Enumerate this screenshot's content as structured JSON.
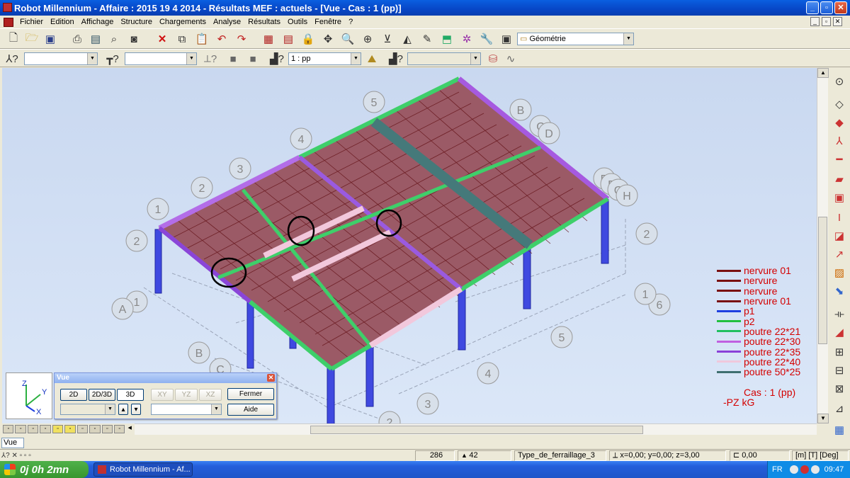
{
  "window": {
    "title": "Robot Millennium - Affaire : 2015 19 4 2014 - Résultats MEF : actuels - [Vue - Cas : 1 (pp)]"
  },
  "menu": [
    "Fichier",
    "Edition",
    "Affichage",
    "Structure",
    "Chargements",
    "Analyse",
    "Résultats",
    "Outils",
    "Fenêtre",
    "?"
  ],
  "toolbar": {
    "layout_select": "Géométrie",
    "case_select": "1 : pp",
    "selection_value": "",
    "bars_value": ""
  },
  "grid_labels": {
    "numbers": [
      "1",
      "2",
      "2",
      "3",
      "4",
      "5",
      "1",
      "2",
      "6",
      "5",
      "4",
      "3",
      "2",
      "1"
    ],
    "letters": [
      "A",
      "B",
      "B",
      "C",
      "C",
      "D",
      "E",
      "F",
      "G",
      "H"
    ]
  },
  "legend": [
    {
      "label": "nervure 01",
      "color": "#7a1010"
    },
    {
      "label": "nervure",
      "color": "#7a1010"
    },
    {
      "label": "nervure",
      "color": "#7a1010"
    },
    {
      "label": "nervure 01",
      "color": "#7a1010"
    },
    {
      "label": "p1",
      "color": "#1f3fe0"
    },
    {
      "label": "p2",
      "color": "#22c040"
    },
    {
      "label": "poutre 22*21",
      "color": "#22c060"
    },
    {
      "label": "poutre 22*30",
      "color": "#c060e0"
    },
    {
      "label": "poutre 22*35",
      "color": "#8a40d8"
    },
    {
      "label": "poutre 22*40",
      "color": "#f0c8dc"
    },
    {
      "label": "poutre 50*25",
      "color": "#3f6f70"
    }
  ],
  "case_label": "Cas : 1 (pp)",
  "unit_label": "-PZ  kG",
  "axes": {
    "z": "Z",
    "y": "Y",
    "x": "X"
  },
  "vue_panel": {
    "title": "Vue",
    "btn_2d": "2D",
    "btn_2d3d": "2D/3D",
    "btn_3d": "3D",
    "btn_xy": "XY",
    "btn_yz": "YZ",
    "btn_xz": "XZ",
    "btn_close": "Fermer",
    "btn_help": "Aide"
  },
  "command": {
    "value": "Vue"
  },
  "status": {
    "nodes": "286",
    "bars": "42",
    "reinf_type": "Type_de_ferraillage_3",
    "coords": "x=0,00; y=0,00; z=3,00",
    "angle": "0,00",
    "units": "[m] [T] [Deg]"
  },
  "taskbar": {
    "start": "0j 0h 2mn",
    "task": "Robot Millennium - Af...",
    "lang": "FR",
    "clock": "09:47"
  }
}
